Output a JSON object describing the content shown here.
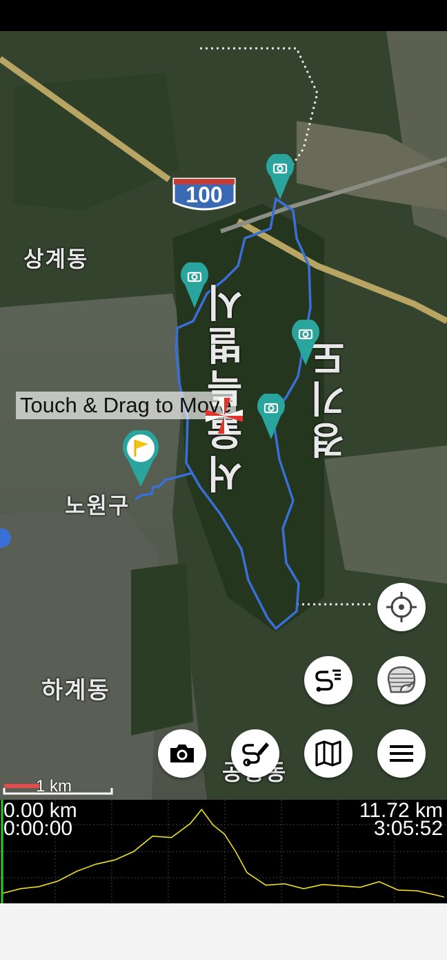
{
  "map": {
    "highway_shield": "100",
    "place_labels": {
      "sanggye": "상계동",
      "nowon": "노원구",
      "hagye": "하계동",
      "gongneung": "공릉동",
      "mountain_left": "서울특별시",
      "mountain_right": "경기도"
    },
    "hint_text": "Touch & Drag to Move",
    "scale_label": "1 km"
  },
  "buttons": {
    "locate": "crosshair-icon",
    "route_list": "route-list-icon",
    "map_layer": "map-layer-icon",
    "camera": "camera-icon",
    "draw_route": "draw-route-icon",
    "map": "map-icon",
    "menu": "menu-icon"
  },
  "profile": {
    "start_distance": "0.00 km",
    "start_time": "0:00:00",
    "end_distance": "11.72 km",
    "end_time": "3:05:52",
    "line_color": "#f0e020",
    "marker_color": "#2bd12b"
  },
  "chart_data": {
    "type": "area",
    "xlim": [
      0,
      11.72
    ],
    "x": [
      0,
      0.5,
      1,
      1.5,
      2,
      2.5,
      3,
      3.5,
      4,
      4.5,
      5,
      5.3,
      5.6,
      5.9,
      6.2,
      6.5,
      7,
      7.5,
      8,
      8.5,
      9,
      9.5,
      10,
      10.5,
      11,
      11.5,
      11.72
    ],
    "y": [
      10,
      17,
      20,
      28,
      42,
      52,
      58,
      70,
      92,
      90,
      110,
      130,
      108,
      95,
      70,
      40,
      22,
      24,
      17,
      23,
      21,
      19,
      27,
      15,
      14,
      8,
      5
    ],
    "series": [
      {
        "values": [
          10,
          17,
          20,
          28,
          42,
          52,
          58,
          70,
          92,
          90,
          110,
          130,
          108,
          95,
          70,
          40,
          22,
          24,
          17,
          23,
          21,
          19,
          27,
          15,
          14,
          8,
          5
        ]
      }
    ]
  }
}
